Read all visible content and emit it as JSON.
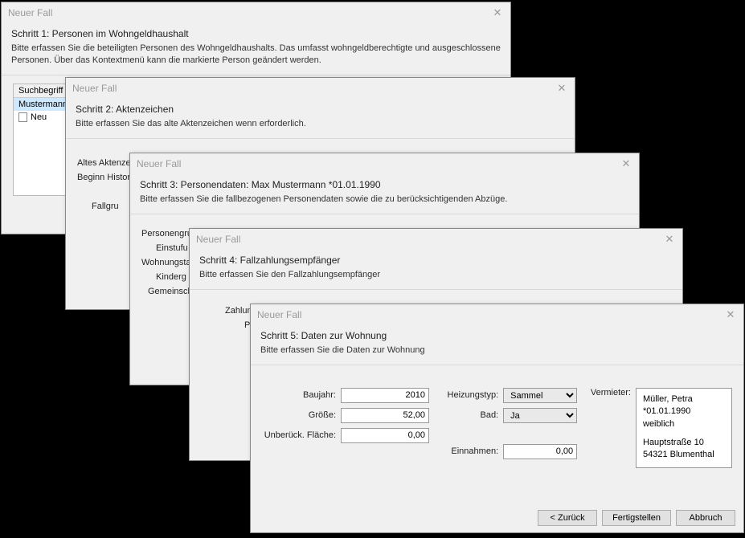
{
  "d1": {
    "title": "Neuer Fall",
    "step": "Schritt 1: Personen im Wohngeldhaushalt",
    "desc": "Bitte erfassen Sie die beteiligten Personen des Wohngeldhaushalts. Das umfasst wohngeldberechtigte und ausgeschlossene Personen. Über das Kontextmenü kann die markierte Person geändert werden.",
    "searchLabel": "Suchbegriff",
    "selected": "Mustermann, M",
    "newLabel": "Neu"
  },
  "d2": {
    "title": "Neuer Fall",
    "step": "Schritt 2: Aktenzeichen",
    "desc": "Bitte erfassen Sie das alte Aktenzeichen wenn erforderlich.",
    "oldAz": "Altes Aktenzeich",
    "begin": "Beginn Histor",
    "fallgr": "Fallgru"
  },
  "d3": {
    "title": "Neuer Fall",
    "step": "Schritt 3: Personendaten: Max Mustermann *01.01.1990",
    "desc": "Bitte erfassen Sie die fallbezogenen Personendaten sowie die zu berücksichtigenden Abzüge.",
    "gruppe": "Personengrup",
    "einstuf": "Einstufu",
    "wohn": "Wohnungsta",
    "kinderg": "Kinderg",
    "gemein": "Gemeinsch"
  },
  "d4": {
    "title": "Neuer Fall",
    "step": "Schritt 4: Fallzahlungsempfänger",
    "desc": "Bitte erfassen Sie den Fallzahlungsempfänger",
    "zahlungs": "Zahlungs",
    "pers": "Pers"
  },
  "d5": {
    "title": "Neuer Fall",
    "step": "Schritt 5: Daten zur Wohnung",
    "desc": "Bitte erfassen Sie die Daten zur Wohnung",
    "labels": {
      "baujahr": "Baujahr:",
      "groesse": "Größe:",
      "unber": "Unberück. Fläche:",
      "heizung": "Heizungstyp:",
      "bad": "Bad:",
      "einn": "Einnahmen:",
      "vermieter": "Vermieter:"
    },
    "values": {
      "baujahr": "2010",
      "groesse": "52,00",
      "unber": "0,00",
      "heizung": "Sammel",
      "bad": "Ja",
      "einn": "0,00"
    },
    "vermieter": {
      "name": "Müller, Petra",
      "birth": "*01.01.1990",
      "gender": "weiblich",
      "street": "Hauptstraße 10",
      "city": "54321 Blumenthal"
    },
    "buttons": {
      "back": "< Zurück",
      "finish": "Fertigstellen",
      "cancel": "Abbruch"
    }
  }
}
